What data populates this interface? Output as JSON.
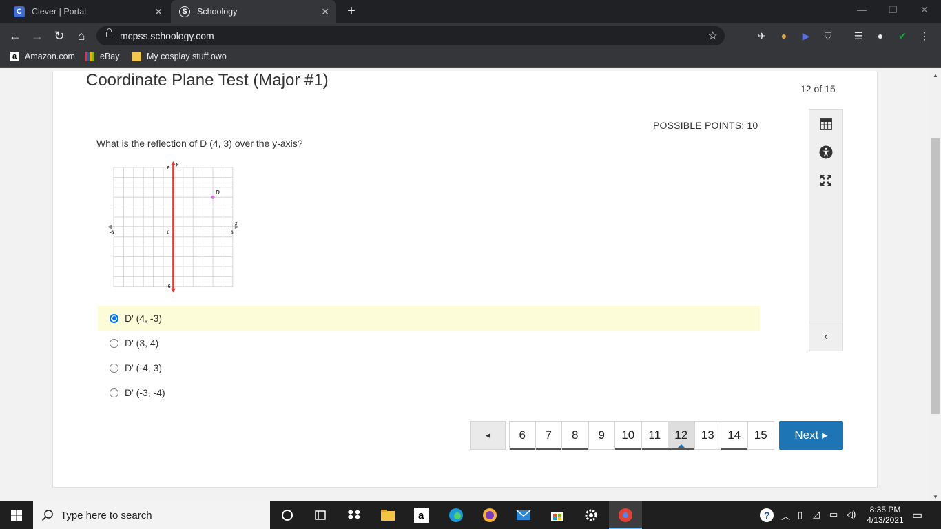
{
  "browser": {
    "tabs": [
      {
        "title": "Clever | Portal",
        "favicon": "C"
      },
      {
        "title": "Schoology",
        "favicon": "S"
      }
    ],
    "url": "mcpss.schoology.com",
    "bookmarks": [
      "Amazon.com",
      "eBay",
      "My cosplay stuff owo"
    ]
  },
  "test": {
    "title": "Coordinate Plane Test (Major #1)",
    "counter": "12 of 15",
    "possible_points": "POSSIBLE POINTS: 10",
    "question": "What is the reflection of D (4, 3) over the y-axis?",
    "answers": [
      {
        "label": "D' (4, -3)",
        "selected": true
      },
      {
        "label": "D' (3, 4)",
        "selected": false
      },
      {
        "label": "D' (-4, 3)",
        "selected": false
      },
      {
        "label": "D' (-3, -4)",
        "selected": false
      }
    ]
  },
  "graph": {
    "axis_min": -6,
    "axis_max": 6,
    "x_min_label": "-6",
    "x_max_label": "6",
    "y_max_label": "6",
    "y_min_label": "-6",
    "origin_label": "0",
    "x_axis_label": "x",
    "y_axis_label": "y",
    "point_label": "D",
    "point": {
      "x": 4,
      "y": 3
    },
    "highlighted_axis": "y",
    "highlight_color": "#e53935",
    "point_color": "#d96ee0"
  },
  "pagination": {
    "prev_symbol": "◄",
    "pages": [
      "6",
      "7",
      "8",
      "9",
      "10",
      "11",
      "12",
      "13",
      "14",
      "15"
    ],
    "current": "12",
    "answered": [
      "6",
      "7",
      "8",
      "10",
      "11",
      "12",
      "14"
    ],
    "next_label": "Next ▸"
  },
  "taskbar": {
    "search_placeholder": "Type here to search",
    "time": "8:35 PM",
    "date": "4/13/2021"
  },
  "colors": {
    "next_button": "#1d75b5",
    "selected_answer_bg": "#fcfcd9"
  }
}
